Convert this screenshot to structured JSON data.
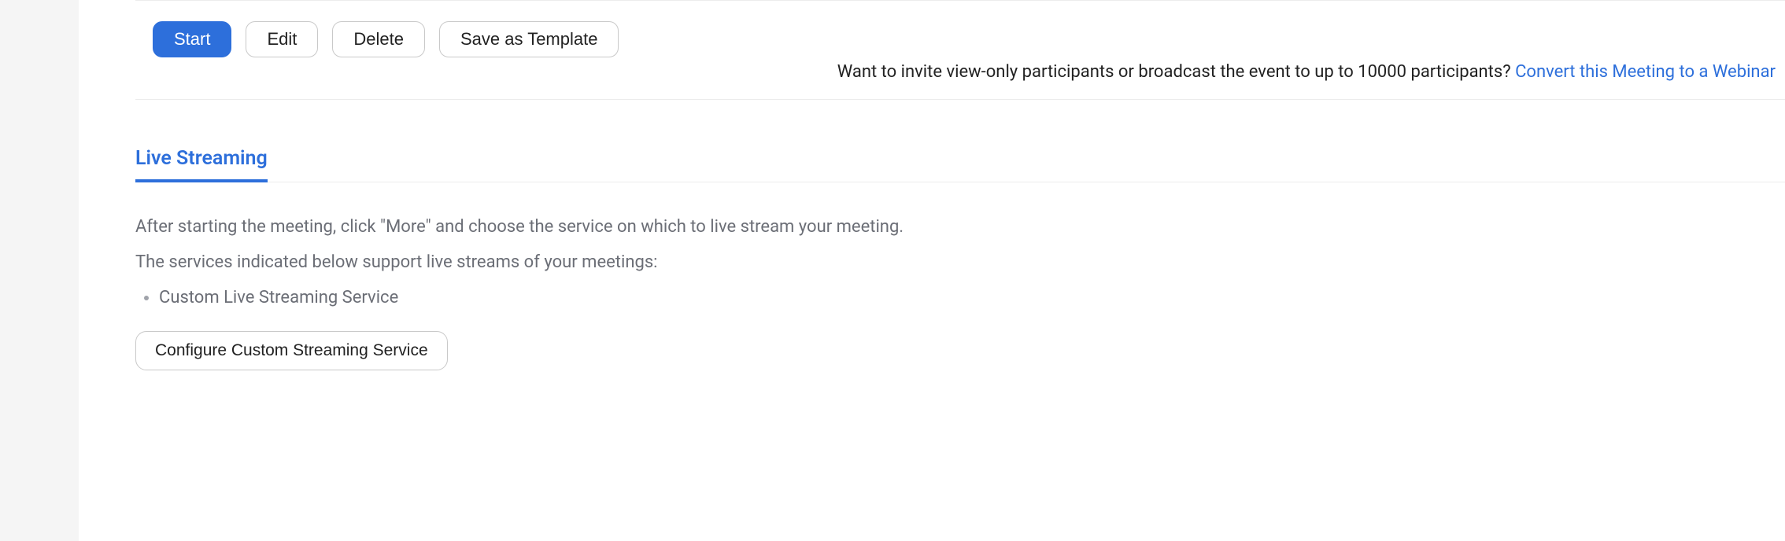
{
  "actions": {
    "start": "Start",
    "edit": "Edit",
    "delete": "Delete",
    "save_template": "Save as Template"
  },
  "webinar_prompt": {
    "text": "Want to invite view-only participants or broadcast the event to up to 10000 participants? ",
    "link": "Convert this Meeting to a Webinar"
  },
  "live_streaming": {
    "tab_label": "Live Streaming",
    "instruction": "After starting the meeting, click \"More\" and choose the service on which to live stream your meeting.",
    "services_intro": "The services indicated below support live streams of your meetings:",
    "services": [
      "Custom Live Streaming Service"
    ],
    "configure_button": "Configure Custom Streaming Service"
  }
}
